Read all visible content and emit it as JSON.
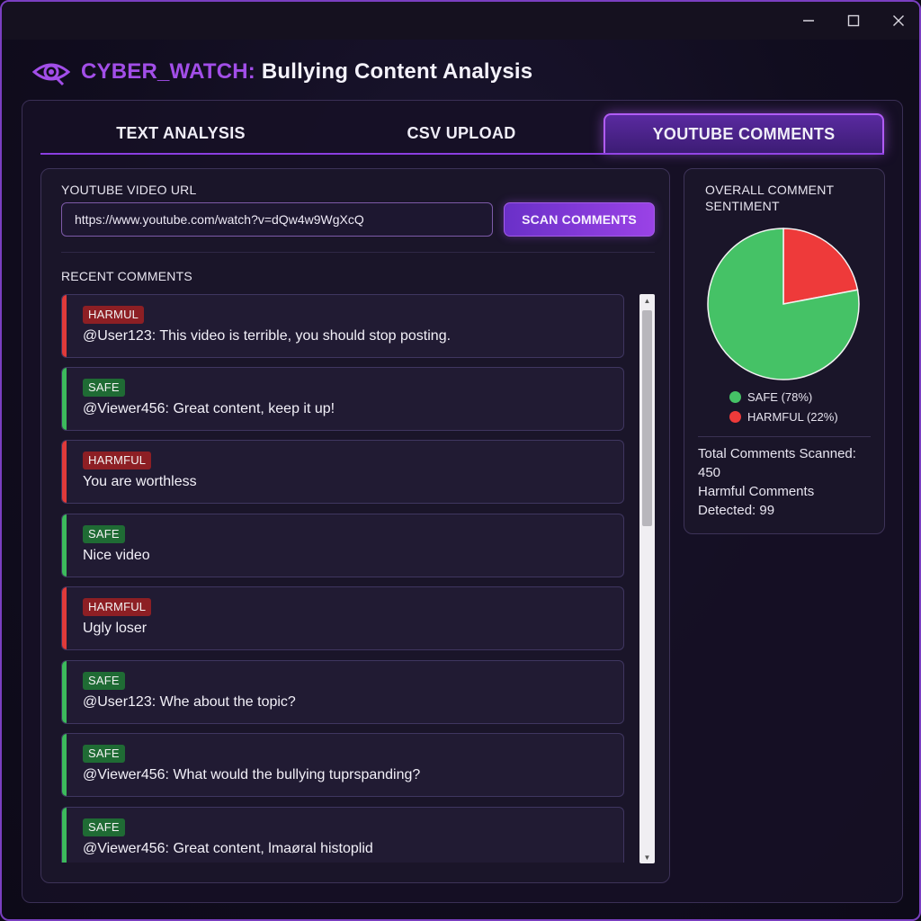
{
  "window": {
    "controls": [
      "minimize-icon",
      "maximize-icon",
      "close-icon"
    ]
  },
  "app": {
    "brand": "CYBER_WATCH:",
    "title": " Bullying Content Analysis",
    "logo_icon": "eye-icon"
  },
  "tabs": [
    {
      "label": "TEXT ANALYSIS",
      "active": false
    },
    {
      "label": "CSV UPLOAD",
      "active": false
    },
    {
      "label": "YOUTUBE COMMENTS",
      "active": true
    }
  ],
  "scan": {
    "url_label": "YOUTUBE VIDEO URL",
    "url_value": "https://www.youtube.com/watch?v=dQw4w9WgXcQ",
    "button_label": "SCAN COMMENTS"
  },
  "comments_section": {
    "label": "RECENT COMMENTS",
    "items": [
      {
        "status": "harmful",
        "badge": "HARMUL",
        "text": "@User123: This video is terrible, you should stop posting."
      },
      {
        "status": "safe",
        "badge": "SAFE",
        "text": "@Viewer456: Great content, keep it up!"
      },
      {
        "status": "harmful",
        "badge": "HARMFUL",
        "text": "You are worthless"
      },
      {
        "status": "safe",
        "badge": "SAFE",
        "text": "Nice video"
      },
      {
        "status": "harmful",
        "badge": "HARMFUL",
        "text": "Ugly loser"
      },
      {
        "status": "safe",
        "badge": "SAFE",
        "text": "@User123: Whe about the topic?"
      },
      {
        "status": "safe",
        "badge": "SAFE",
        "text": "@Viewer456: What would the bullying tuprspanding?"
      },
      {
        "status": "safe",
        "badge": "SAFE",
        "text": "@Viewer456: Great content, lmaøral histoplid"
      }
    ]
  },
  "sentiment": {
    "title_line1": "OVERALL COMMENT",
    "title_line2": "SENTIMENT",
    "safe_label": "SAFE (78%)",
    "harmful_label": "HARMFUL (22%)",
    "stat_line1": "Total Comments Scanned:",
    "stat_line2": "450",
    "stat_line3": "Harmful Comments",
    "stat_line4": "Detected: 99"
  },
  "colors": {
    "safe": "#3cba5c",
    "harmful": "#e03a3a",
    "accent": "#a24ee8"
  },
  "chart_data": {
    "type": "pie",
    "categories": [
      "SAFE",
      "HARMFUL"
    ],
    "values": [
      78,
      22
    ],
    "colors": [
      "#45c266",
      "#ee3a3a"
    ],
    "title": "OVERALL COMMENT SENTIMENT"
  }
}
